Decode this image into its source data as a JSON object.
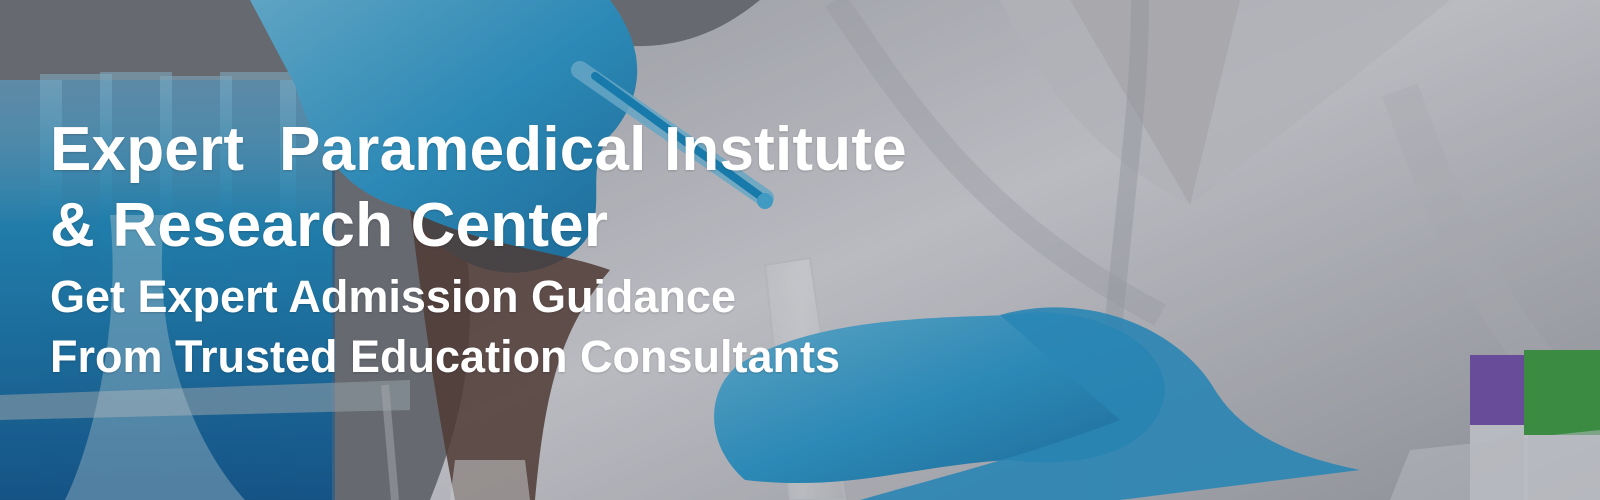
{
  "banner": {
    "headline_line1": "Expert  Paramedical Institute",
    "headline_line2": "& Research Center",
    "subheadline_line1": "Get Expert Admission Guidance",
    "subheadline_line2": "From Trusted Education Consultants"
  },
  "colors": {
    "text": "#ffffff",
    "glove_blue": "#2f9fd6",
    "lab_coat": "#d6d6dc",
    "overlay": "rgba(35, 38, 48, 0.20)"
  }
}
